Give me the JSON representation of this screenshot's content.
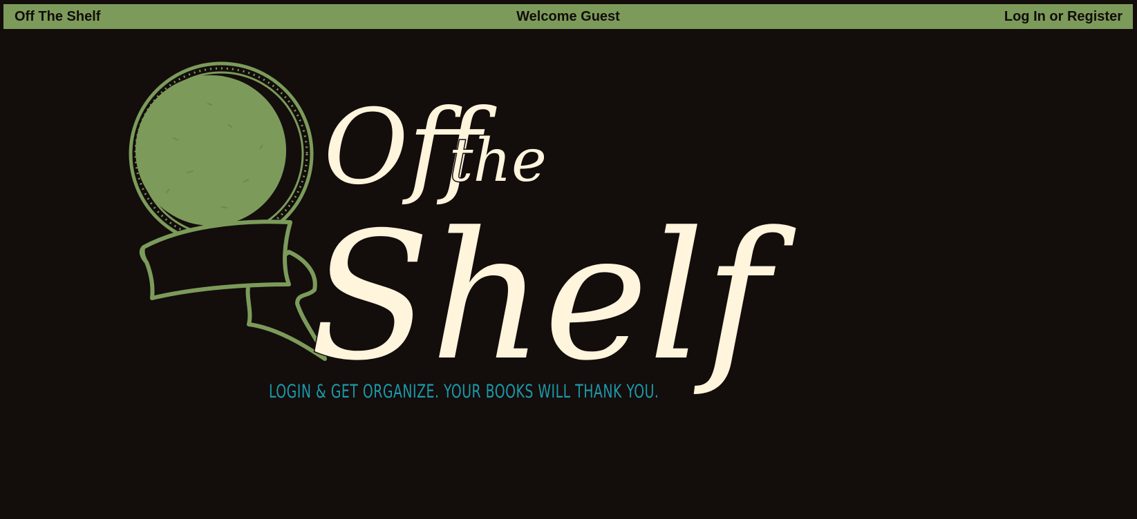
{
  "navbar": {
    "brand": "Off The Shelf",
    "welcome": "Welcome Guest",
    "auth_link": "Log In or Register"
  },
  "hero": {
    "logo_line1": "Off",
    "logo_line2": "the",
    "logo_line3": "Shelf",
    "tagline": "LOGIN & GET ORGANIZE. YOUR BOOKS WILL THANK YOU."
  },
  "colors": {
    "background": "#130d0c",
    "navbar": "#7c9b5a",
    "logo_green": "#7c9b5a",
    "logo_cream": "#fff4dc",
    "tagline": "#1b9aaa"
  }
}
